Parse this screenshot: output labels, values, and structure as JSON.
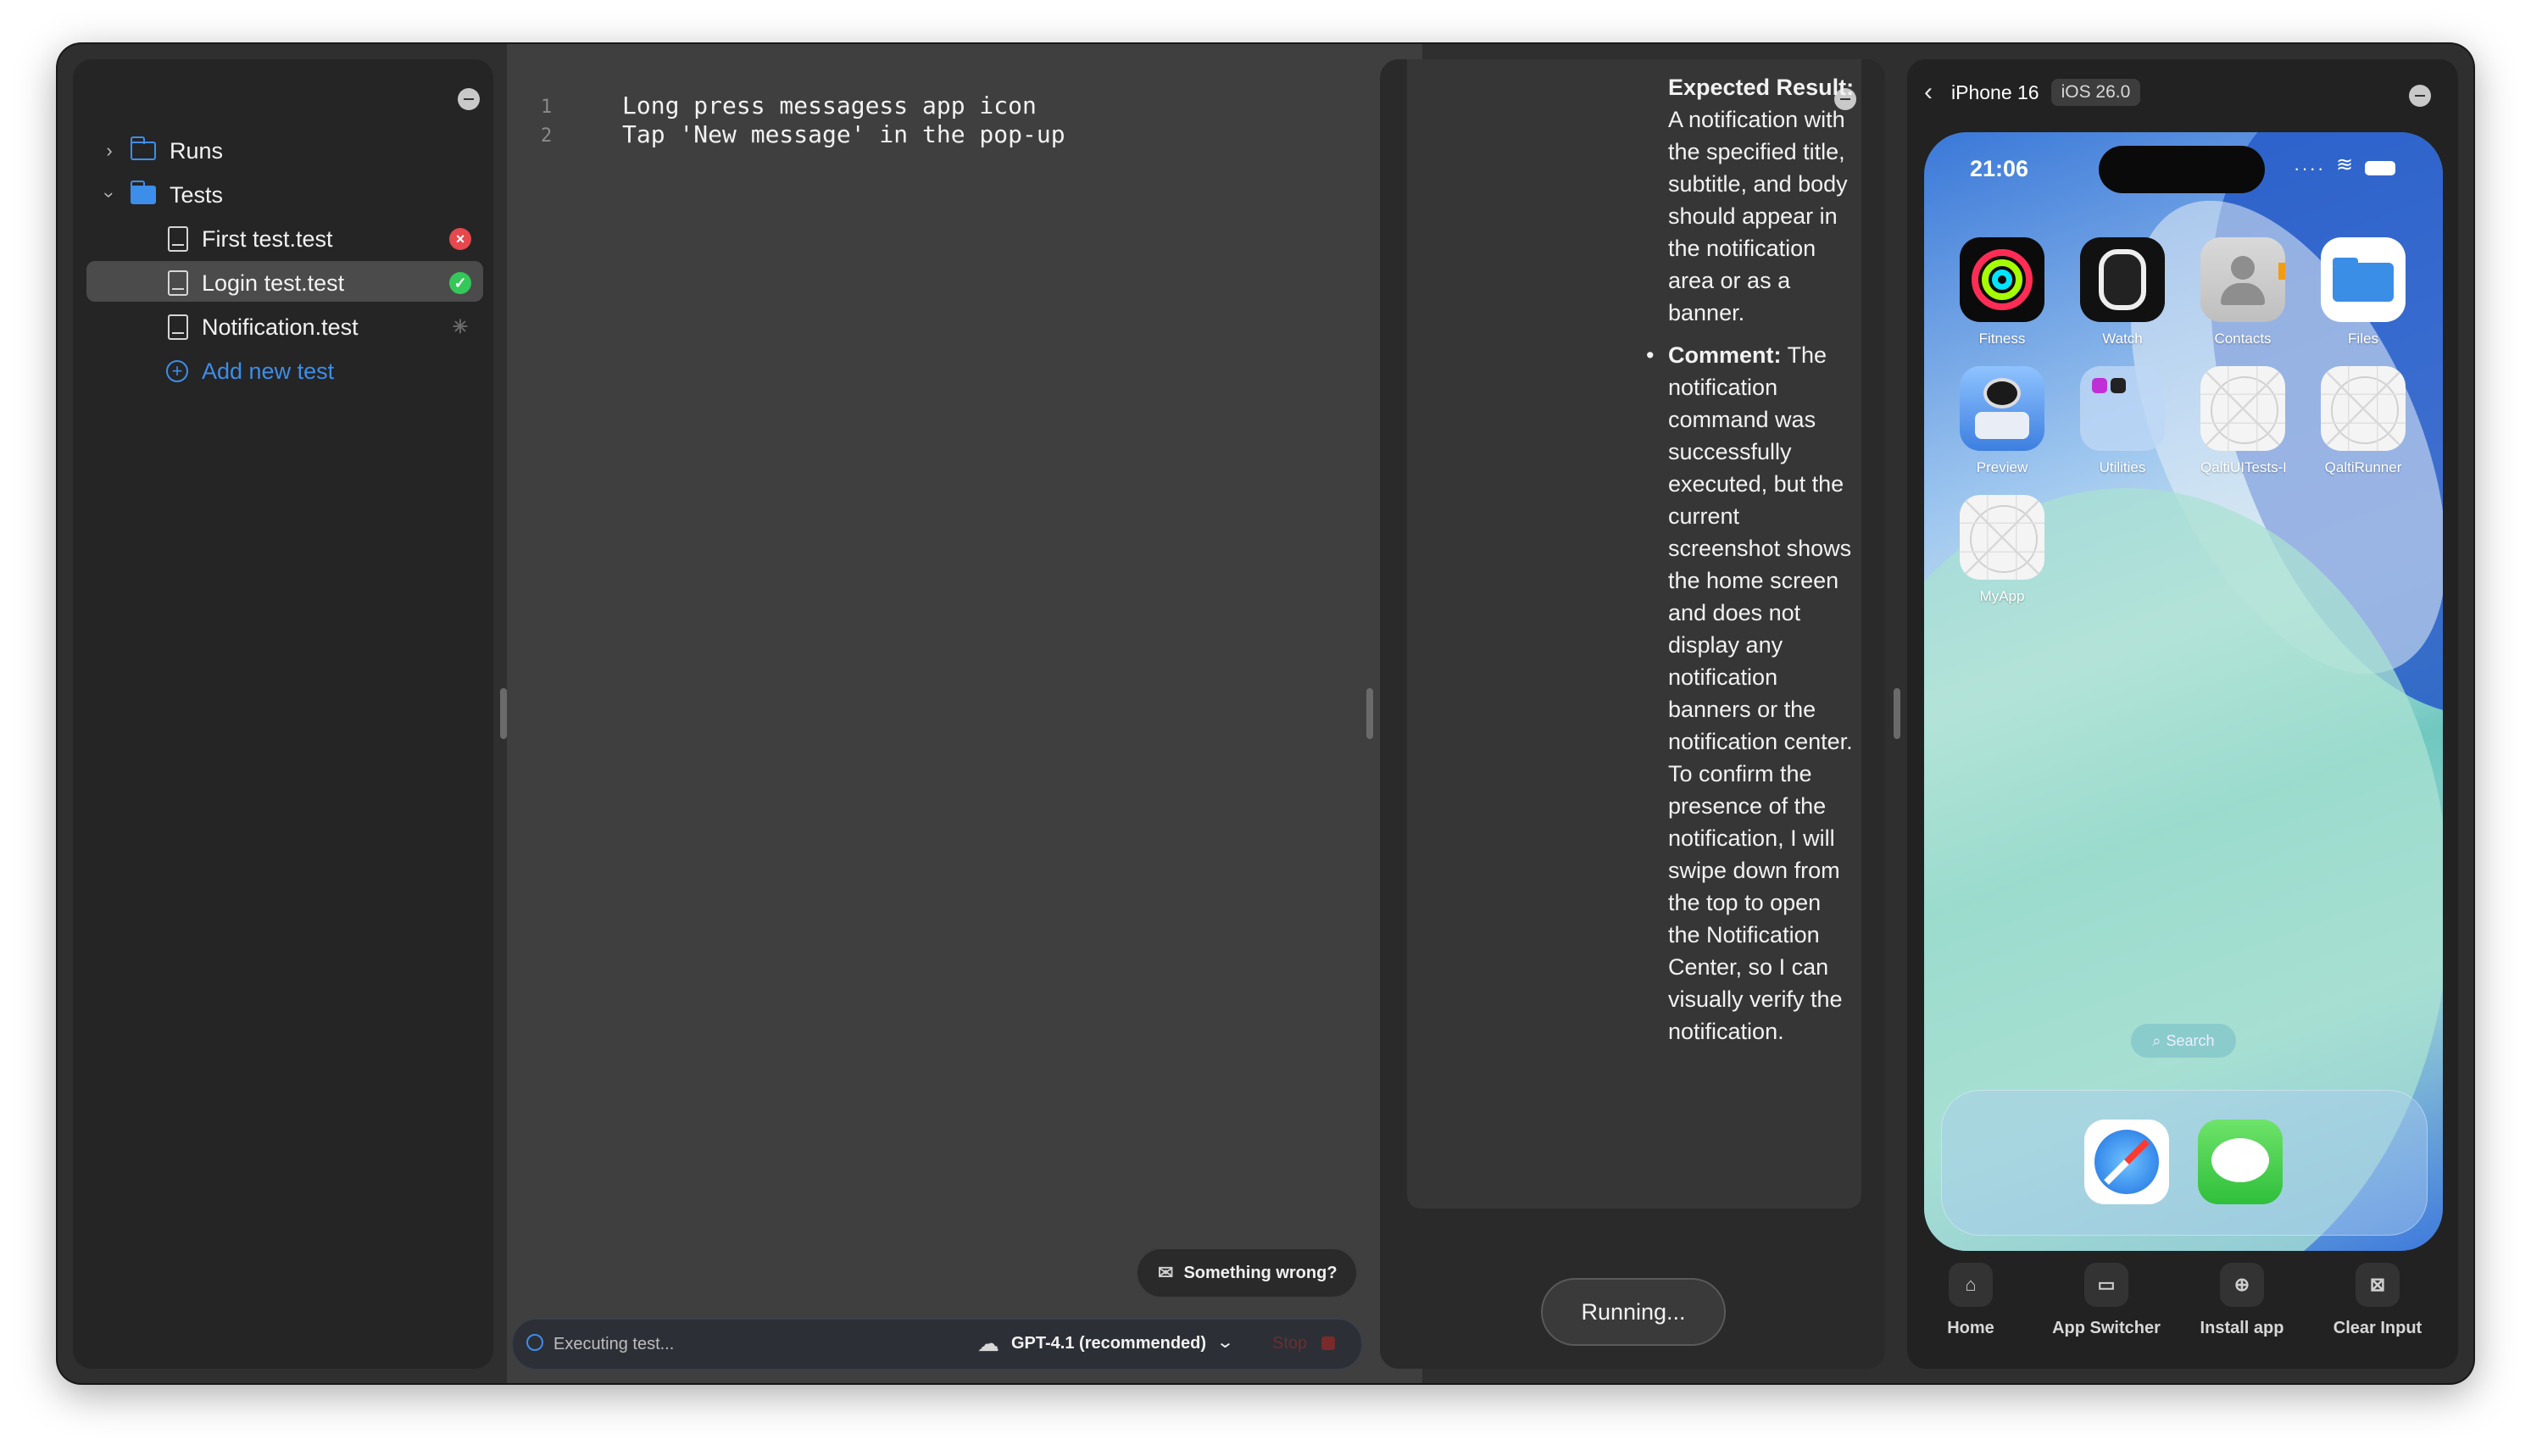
{
  "sidebar": {
    "runs_label": "Runs",
    "tests_label": "Tests",
    "items": [
      {
        "label": "First test.test",
        "status": "failed"
      },
      {
        "label": "Login test.test",
        "status": "passed"
      },
      {
        "label": "Notification.test",
        "status": "running"
      }
    ],
    "add_label": "Add new test"
  },
  "editor": {
    "lines": [
      {
        "num": "1",
        "text": "Long press messagess app icon"
      },
      {
        "num": "2",
        "text": "Tap 'New message' in the pop-up"
      }
    ],
    "feedback_label": "Something wrong?",
    "status_text": "Executing test...",
    "model_label": "GPT-4.1 (recommended)",
    "stop_label": "Stop"
  },
  "results": {
    "expected_title": "Expected Result:",
    "expected_text": " A notification with the specified title, subtitle, and body should appear in the notification area or as a banner.",
    "comment_title": "Comment:",
    "comment_text": " The notification command was successfully executed, but the current screenshot shows the home screen and does not display any notification banners or the notification center. To confirm the presence of the notification, I will swipe down from the top to open the Notification Center, so I can visually verify the notification.",
    "running_label": "Running..."
  },
  "device": {
    "name": "iPhone 16",
    "os": "iOS 26.0",
    "time": "21:06",
    "apps": [
      {
        "label": "Fitness",
        "icon": "fitness-icon"
      },
      {
        "label": "Watch",
        "icon": "watch-icon"
      },
      {
        "label": "Contacts",
        "icon": "contacts-icon"
      },
      {
        "label": "Files",
        "icon": "files-icon"
      },
      {
        "label": "Preview",
        "icon": "preview-icon"
      },
      {
        "label": "Utilities",
        "icon": "utilities-icon"
      },
      {
        "label": "QaltiUITests-Ru...",
        "icon": "placeholder-app-icon"
      },
      {
        "label": "QaltiRunner",
        "icon": "placeholder-app-icon"
      },
      {
        "label": "MyApp",
        "icon": "placeholder-app-icon"
      }
    ],
    "search_label": "Search",
    "dock": [
      {
        "icon": "safari-icon"
      },
      {
        "icon": "messages-icon"
      }
    ],
    "controls": [
      {
        "label": "Home",
        "icon": "home-icon"
      },
      {
        "label": "App Switcher",
        "icon": "app-switcher-icon"
      },
      {
        "label": "Install app",
        "icon": "install-app-icon"
      },
      {
        "label": "Clear Input",
        "icon": "clear-input-icon"
      }
    ]
  },
  "colors": {
    "accent": "#3d8eea",
    "status_failed": "#e5484d",
    "status_passed": "#34c759"
  }
}
